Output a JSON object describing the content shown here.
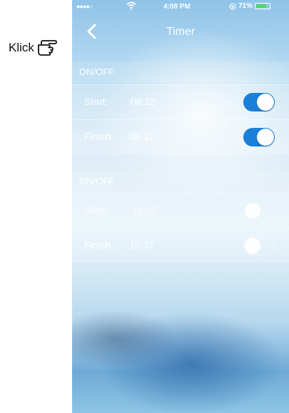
{
  "annotation": {
    "label": "Klick",
    "icon": "pointing-hand-icon"
  },
  "status_bar": {
    "signal": "●●●●○",
    "time": "4:08 PM",
    "battery_text": "71%"
  },
  "navbar": {
    "title": "Timer",
    "back_icon": "chevron-left-icon"
  },
  "timers": [
    {
      "header": "ON/OFF",
      "start_label": "Start:",
      "start_value": "08:12",
      "start_enabled": true,
      "finish_label": "Finish:",
      "finish_value": "08:11",
      "finish_enabled": true
    },
    {
      "header": "ON/OFF",
      "start_label": "Start:",
      "start_value": "16:35",
      "start_enabled": false,
      "finish_label": "Finish:",
      "finish_value": "16:37",
      "finish_enabled": false
    }
  ],
  "colors": {
    "toggle_on": "#1a7fd9",
    "battery_fill": "#4cd964"
  }
}
